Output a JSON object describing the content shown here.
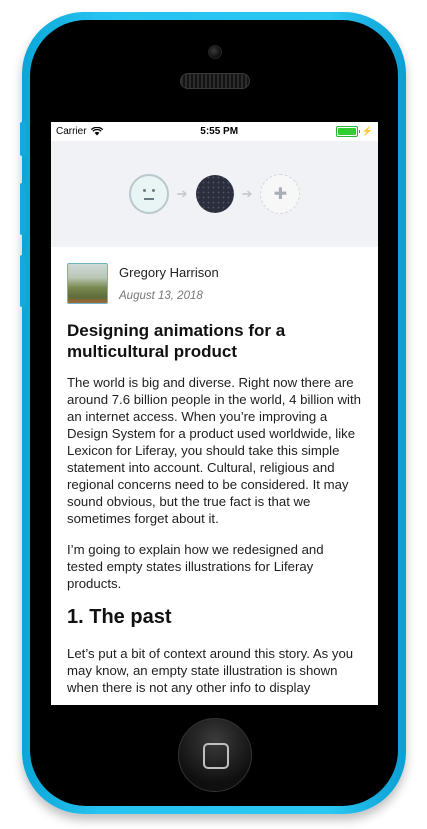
{
  "status": {
    "carrier": "Carrier",
    "time": "5:55 PM"
  },
  "hero": {
    "icons": [
      "neutral-face-icon",
      "arrow-right-icon",
      "dark-dots-circle-icon",
      "arrow-right-icon",
      "puzzle-icon"
    ]
  },
  "article": {
    "author": "Gregory Harrison",
    "date": "August 13, 2018",
    "title": "Designing animations for a multicultural product",
    "paragraphs": [
      "The world is big and diverse. Right now there are around 7.6 billion people in the world, 4 billion with an internet access. When you’re improving a Design System for a product used worldwide, like Lexicon for Liferay, you should take this simple statement into account. Cultural, religious and regional concerns need to be considered. It may sound obvious, but the true fact is that we sometimes forget about it.",
      "I’m going to explain how we redesigned and tested empty states illustrations for Liferay products."
    ],
    "section_heading": "1. The past",
    "section_paragraph": "Let’s put a bit of context around this story. As you may know, an empty state illustration is shown when there is not any other info to display"
  },
  "colors": {
    "device": "#26c3f0",
    "battery": "#33cc33",
    "hero_bg": "#f1f2f5"
  }
}
